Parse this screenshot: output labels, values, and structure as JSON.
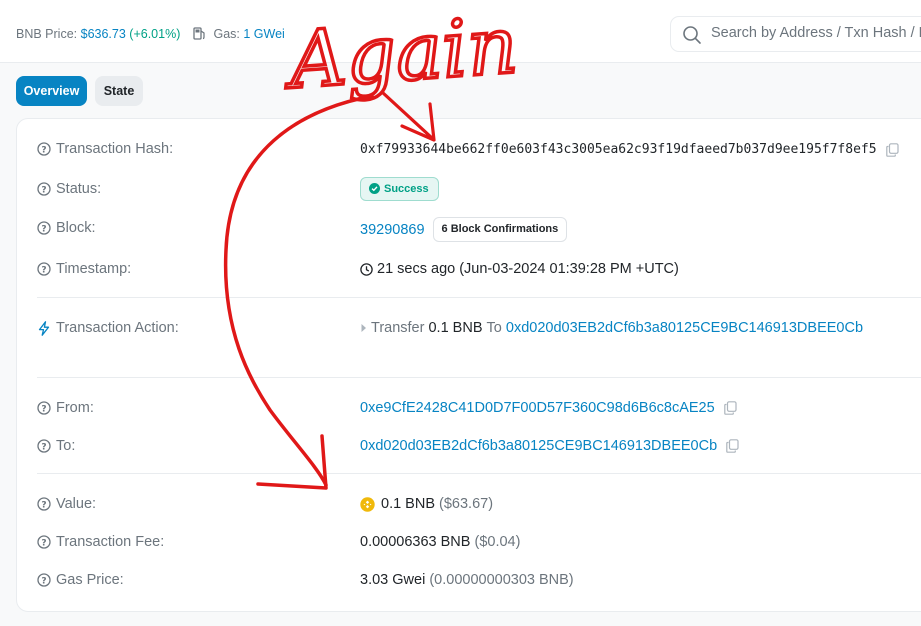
{
  "header": {
    "bnb_price_label": "BNB Price:",
    "bnb_price_value": "$636.73",
    "bnb_price_change": "(+6.01%)",
    "gas_label": "Gas:",
    "gas_value": "1 GWei",
    "search_placeholder": "Search by Address / Txn Hash / Block / Token / Domain Name"
  },
  "tabs": [
    {
      "label": "Overview",
      "active": true
    },
    {
      "label": "State",
      "active": false
    }
  ],
  "details": {
    "tx_hash_label": "Transaction Hash:",
    "tx_hash": "0xf79933644be662ff0e603f43c3005ea62c93f19dfaeed7b037d9ee195f7f8ef5",
    "status_label": "Status:",
    "status": "Success",
    "block_label": "Block:",
    "block": "39290869",
    "block_confirmations": "6 Block Confirmations",
    "timestamp_label": "Timestamp:",
    "timestamp": "21 secs ago (Jun-03-2024 01:39:28 PM +UTC)",
    "action_label": "Transaction Action:",
    "action_verb": "Transfer",
    "action_amount": "0.1 BNB",
    "action_to_word": "To",
    "action_to_address": "0xd020d03EB2dCf6b3a80125CE9BC146913DBEE0Cb",
    "from_label": "From:",
    "from": "0xe9CfE2428C41D0D7F00D57F360C98d6B6c8cAE25",
    "to_label": "To:",
    "to": "0xd020d03EB2dCf6b3a80125CE9BC146913DBEE0Cb",
    "value_label": "Value:",
    "value": "0.1 BNB",
    "value_usd": "($63.67)",
    "fee_label": "Transaction Fee:",
    "fee": "0.00006363 BNB",
    "fee_usd": "($0.04)",
    "gas_price_label": "Gas Price:",
    "gas_price": "3.03 Gwei",
    "gas_price_bnb": "(0.00000000303 BNB)"
  },
  "annotation": {
    "text": "Again",
    "color": "#e01818"
  },
  "colors": {
    "accent": "#0784c3",
    "success": "#00a186",
    "muted": "#6c757d"
  }
}
